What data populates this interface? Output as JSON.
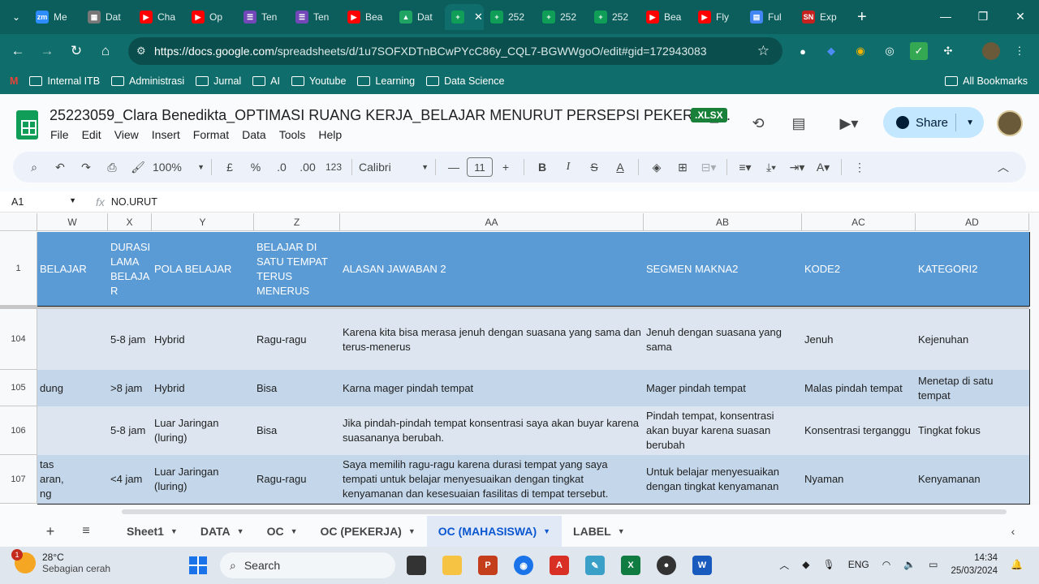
{
  "browser": {
    "tabs": [
      {
        "label": "Me",
        "color": "#2d8cff",
        "glyph": "zm"
      },
      {
        "label": "Dat",
        "color": "#777777",
        "glyph": "▦"
      },
      {
        "label": "Cha",
        "color": "#ff0000",
        "glyph": "▶"
      },
      {
        "label": "Op",
        "color": "#ff0000",
        "glyph": "▶"
      },
      {
        "label": "Ten",
        "color": "#7248b9",
        "glyph": "☰"
      },
      {
        "label": "Ten",
        "color": "#7248b9",
        "glyph": "☰"
      },
      {
        "label": "Bea",
        "color": "#ff0000",
        "glyph": "▶"
      },
      {
        "label": "Dat",
        "color": "#1fa463",
        "glyph": "▲"
      },
      {
        "label": "",
        "color": "#0f9d58",
        "glyph": "+",
        "active": true
      },
      {
        "label": "252",
        "color": "#0f9d58",
        "glyph": "+"
      },
      {
        "label": "252",
        "color": "#0f9d58",
        "glyph": "+"
      },
      {
        "label": "252",
        "color": "#0f9d58",
        "glyph": "+"
      },
      {
        "label": "Bea",
        "color": "#ff0000",
        "glyph": "▶"
      },
      {
        "label": "Fly",
        "color": "#ff0000",
        "glyph": "▶"
      },
      {
        "label": "Ful",
        "color": "#4285f4",
        "glyph": "▤"
      },
      {
        "label": "Exp",
        "color": "#c5221f",
        "glyph": "SN"
      }
    ],
    "url_host": "https://docs.google.com",
    "url_path": "/spreadsheets/d/1u7SOFXDTnBCwPYcC86y_CQL7-BGWWgoO/edit#gid=172943083",
    "bookmarks": [
      "Internal ITB",
      "Administrasi",
      "Jurnal",
      "AI",
      "Youtube",
      "Learning",
      "Data Science"
    ],
    "all_bookmarks": "All Bookmarks"
  },
  "doc": {
    "title": "25223059_Clara Benedikta_OPTIMASI RUANG KERJA_BELAJAR MENURUT PERSEPSI PEKERJA_...",
    "badge": ".XLSX",
    "menus": [
      "File",
      "Edit",
      "View",
      "Insert",
      "Format",
      "Data",
      "Tools",
      "Help"
    ],
    "share": "Share"
  },
  "toolbar": {
    "zoom": "100%",
    "currency": "£",
    "percent": "%",
    "dec_less": ".0",
    "dec_more": ".00",
    "format_123": "123",
    "font": "Calibri",
    "font_size": "11"
  },
  "formula": {
    "cell_ref": "A1",
    "fx": "fx",
    "value": "NO.URUT"
  },
  "grid": {
    "columns": [
      "W",
      "X",
      "Y",
      "Z",
      "AA",
      "AB",
      "AC",
      "AD"
    ],
    "header_row": {
      "num": "1",
      "cells": [
        "BELAJAR",
        "DURASI LAMA BELAJA R",
        "POLA BELAJAR",
        "BELAJAR DI SATU TEMPAT TERUS MENERUS",
        "ALASAN JAWABAN 2",
        "SEGMEN MAKNA2",
        "KODE2",
        "KATEGORI2"
      ]
    },
    "rows": [
      {
        "num": "104",
        "cells": [
          "",
          "5-8 jam",
          "Hybrid",
          "Ragu-ragu",
          "Karena kita bisa merasa jenuh dengan suasana yang sama dan terus-menerus",
          "Jenuh dengan suasana yang sama",
          "Jenuh",
          "Kejenuhan"
        ]
      },
      {
        "num": "105",
        "cells": [
          "dung",
          ">8 jam",
          "Hybrid",
          "Bisa",
          "Karna mager pindah tempat",
          "Mager pindah tempat",
          "Malas pindah tempat",
          "Menetap di satu tempat"
        ]
      },
      {
        "num": "106",
        "cells": [
          "",
          "5-8 jam",
          "Luar Jaringan (luring)",
          "Bisa",
          "Jika pindah-pindah tempat konsentrasi saya akan buyar karena suasananya berubah.",
          "Pindah tempat, konsentrasi akan buyar karena suasan berubah",
          "Konsentrasi terganggu",
          "Tingkat fokus"
        ]
      },
      {
        "num": "107",
        "cells": [
          "tas\naran,\nng",
          "<4 jam",
          "Luar Jaringan (luring)",
          "Ragu-ragu",
          "Saya memilih ragu-ragu karena durasi tempat yang saya tempati untuk belajar menyesuaikan dengan tingkat kenyamanan dan kesesuaian fasilitas di tempat tersebut.",
          "Untuk belajar menyesuaikan dengan tingkat kenyamanan",
          "Nyaman",
          "Kenyamanan"
        ]
      }
    ]
  },
  "sheets": {
    "tabs": [
      "Sheet1",
      "DATA",
      "OC",
      "OC (PEKERJA)",
      "OC (MAHASISWA)",
      "LABEL"
    ],
    "active": "OC (MAHASISWA)"
  },
  "taskbar": {
    "temp": "28°C",
    "weather": "Sebagian cerah",
    "notif": "1",
    "search": "Search",
    "lang": "ENG",
    "time": "14:34",
    "date": "25/03/2024"
  },
  "colors": {
    "header_fill": "#5b9bd5",
    "row_light": "#dde6f0",
    "row_mid": "#c3d6ea",
    "chrome_teal": "#0f6e6b"
  }
}
